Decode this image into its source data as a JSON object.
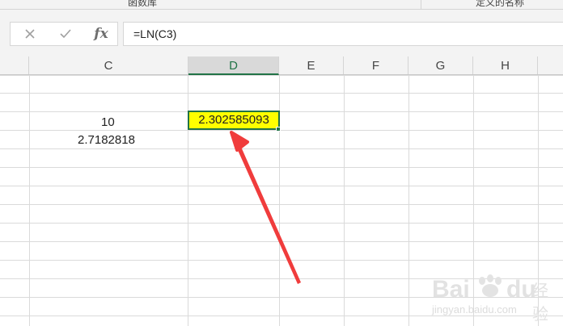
{
  "ribbon": {
    "group_left": "函数库",
    "group_right": "定义的名称"
  },
  "formula_bar": {
    "cancel_icon": "close-icon",
    "enter_icon": "check-icon",
    "insert_function_label": "fx",
    "formula": "=LN(C3)"
  },
  "columns": {
    "c": "C",
    "d": "D",
    "e": "E",
    "f": "F",
    "g": "G",
    "h": "H"
  },
  "cells": {
    "c3": "10",
    "c4": "2.7182818",
    "d3": "2.302585093"
  },
  "colors": {
    "accent": "#217346",
    "highlight": "#ffff00",
    "arrow": "#f03c3c"
  },
  "watermark": {
    "brand": "Bai",
    "brand2": "du",
    "brand_cn": "经验",
    "url": "jingyan.baidu.com"
  }
}
